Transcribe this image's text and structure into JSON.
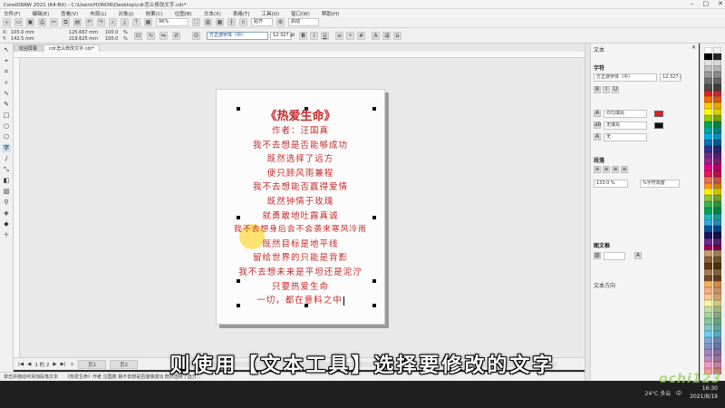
{
  "window": {
    "title": "CorelDRAW 2021 (64-Bit) - C:\\Users\\HONOR\\Desktop\\cdr怎么修改文字.cdr*"
  },
  "menu": [
    "文件(F)",
    "编辑(E)",
    "查看(V)",
    "布局(L)",
    "对象(J)",
    "效果(C)",
    "位图(B)",
    "文本(X)",
    "表格(T)",
    "工具(O)",
    "窗口(W)",
    "帮助(H)"
  ],
  "toolbar": {
    "zoom": "96%",
    "snap_label": "贴齐",
    "launch_label": "启动"
  },
  "propbar": {
    "x": "105.0 mm",
    "y": "142.5 mm",
    "w": "125.667 mm",
    "h": "219.625 mm",
    "sx": "100.0",
    "sy": "100.0",
    "font": "方正游罗体（中）",
    "size": "12.327 pt"
  },
  "doc_tabs": [
    "欢迎屏幕",
    "cdr怎么修改文字.cdr*"
  ],
  "poem": {
    "title": "《热爱生命》",
    "lines": [
      "作者：汪国真",
      "我不去想是否能够成功",
      "既然选择了远方",
      "便只顾风雨兼程",
      "我不去想能否赢得爱情",
      "既然钟情于玫瑰",
      "就勇敢地吐露真诚",
      "我不去想身后会不会袭来寒风冷雨",
      "既然目标是地平线",
      "留给世界的只能是背影",
      "我不去想未来是平坦还是泥泞",
      "只要热爱生命",
      "一切，都在意料之中"
    ]
  },
  "pagebar": {
    "page_info": "1 的 2",
    "pages": [
      "页1",
      "页2"
    ]
  },
  "status": {
    "hint": "单击并拖动可添加段落文本",
    "info": "《热爱生命》作者 汪国真 我不去想是否能够成功 既然选择了远方..."
  },
  "subtitle": "则使用【文本工具】选择要修改的文字",
  "docker": {
    "header": "文本",
    "char_section": "字符",
    "font": "方正游罗体（中）",
    "size": "12.327 pt",
    "fill": "均匀填充",
    "bg": "无填充",
    "outline": "无",
    "para_section": "段落",
    "line_spacing": "133.0 %",
    "spacing_unit": "%字符高度",
    "frame_section": "图文框",
    "text_direction": "文本方向"
  },
  "taskbar": {
    "weather": "24°C 多云",
    "lang": "中",
    "time": "16:30",
    "date": "2021/8/19"
  },
  "watermark": "ochi123",
  "colors": {
    "poem_red": "#c72a2a",
    "highlight": "#ffcc00",
    "fill_swatch": "#e02020"
  }
}
